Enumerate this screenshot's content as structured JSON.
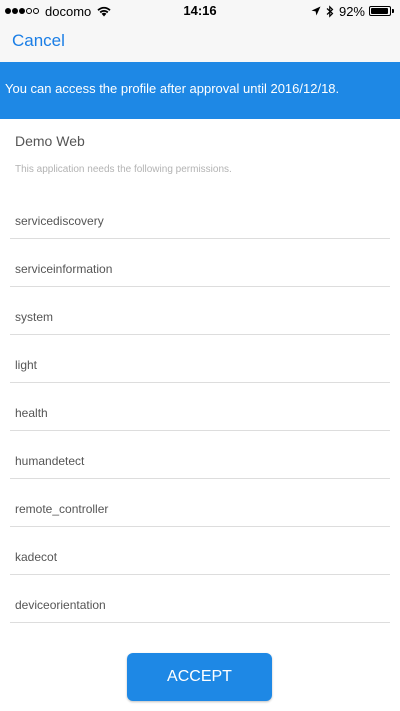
{
  "status_bar": {
    "carrier": "docomo",
    "time": "14:16",
    "battery_percent": "92%",
    "battery_level": 0.92,
    "signal_bars_filled": 3,
    "signal_bars_total": 5
  },
  "nav": {
    "cancel_label": "Cancel"
  },
  "banner": {
    "message": "You can access the profile after approval until 2016/12/18."
  },
  "app": {
    "name": "Demo Web",
    "description": "This application needs the following permissions."
  },
  "permissions": [
    "servicediscovery",
    "serviceinformation",
    "system",
    "light",
    "health",
    "humandetect",
    "remote_controller",
    "kadecot",
    "deviceorientation"
  ],
  "actions": {
    "accept_label": "ACCEPT"
  },
  "colors": {
    "accent": "#1e88e5",
    "link": "#1a7ee6"
  }
}
